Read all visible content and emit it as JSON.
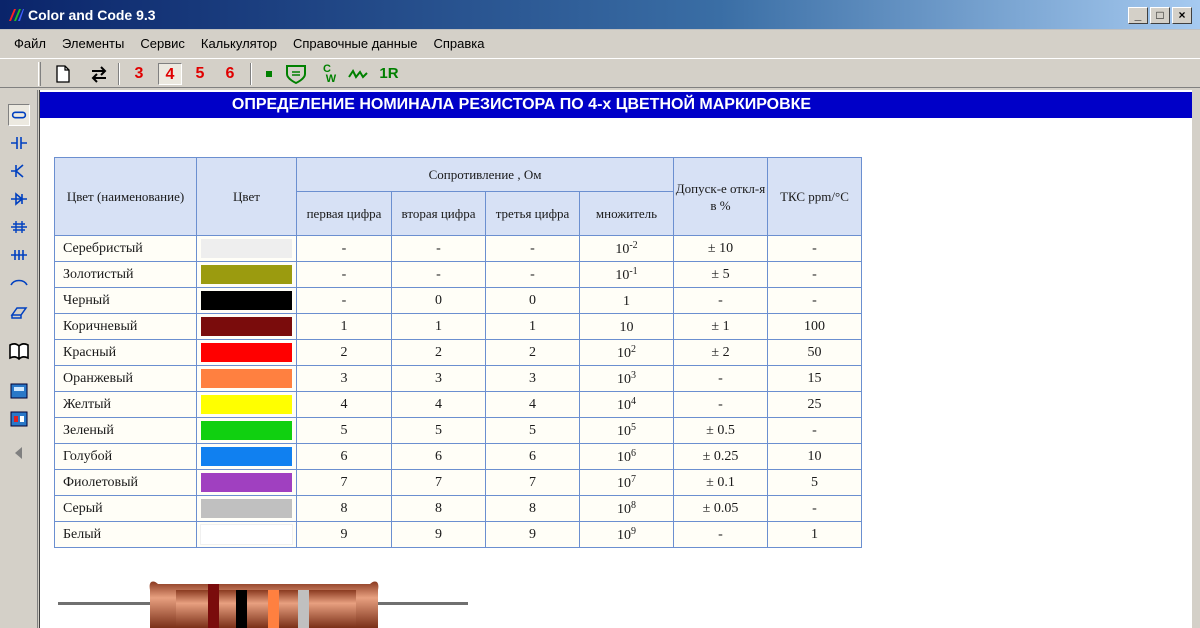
{
  "window": {
    "title": "Color and Code 9.3",
    "minimize": "_",
    "maximize": "□",
    "close": "×"
  },
  "menu": [
    "Файл",
    "Элементы",
    "Сервис",
    "Калькулятор",
    "Справочные данные",
    "Справка"
  ],
  "toolbar": {
    "band3": "3",
    "band4": "4",
    "band5": "5",
    "band6": "6",
    "one_r": "1R",
    "cc_top": "C",
    "cc_bottom": "W"
  },
  "banner": "ОПРЕДЕЛЕНИЕ НОМИНАЛА РЕЗИСТОРА ПО 4-х ЦВЕТНОЙ МАРКИРОВКЕ",
  "table": {
    "headers": {
      "color_name": "Цвет (наименование)",
      "color": "Цвет",
      "resistance": "Сопротивление , Ом",
      "first_digit": "первая цифра",
      "second_digit": "вторая цифра",
      "third_digit": "третья цифра",
      "multiplier": "множитель",
      "tolerance": "Допуск-е откл-я в %",
      "tcr": "ТКС ppm/°C"
    },
    "rows": [
      {
        "name": "Серебристый",
        "color": "#eeeeee",
        "d1": "-",
        "d2": "-",
        "d3": "-",
        "mult_base": "10",
        "mult_exp": "-2",
        "tol": "± 10",
        "tcr": "-"
      },
      {
        "name": "Золотистый",
        "color": "#9b9b0f",
        "d1": "-",
        "d2": "-",
        "d3": "-",
        "mult_base": "10",
        "mult_exp": "-1",
        "tol": "± 5",
        "tcr": "-"
      },
      {
        "name": "Черный",
        "color": "#000000",
        "d1": "-",
        "d2": "0",
        "d3": "0",
        "mult_base": "1",
        "mult_exp": "",
        "tol": "-",
        "tcr": "-"
      },
      {
        "name": "Коричневый",
        "color": "#7a0c0c",
        "d1": "1",
        "d2": "1",
        "d3": "1",
        "mult_base": "10",
        "mult_exp": "",
        "tol": "± 1",
        "tcr": "100"
      },
      {
        "name": "Красный",
        "color": "#ff0000",
        "d1": "2",
        "d2": "2",
        "d3": "2",
        "mult_base": "10",
        "mult_exp": "2",
        "tol": "± 2",
        "tcr": "50"
      },
      {
        "name": "Оранжевый",
        "color": "#ff8040",
        "d1": "3",
        "d2": "3",
        "d3": "3",
        "mult_base": "10",
        "mult_exp": "3",
        "tol": "-",
        "tcr": "15"
      },
      {
        "name": "Желтый",
        "color": "#ffff00",
        "d1": "4",
        "d2": "4",
        "d3": "4",
        "mult_base": "10",
        "mult_exp": "4",
        "tol": "-",
        "tcr": "25"
      },
      {
        "name": "Зеленый",
        "color": "#10d010",
        "d1": "5",
        "d2": "5",
        "d3": "5",
        "mult_base": "10",
        "mult_exp": "5",
        "tol": "± 0.5",
        "tcr": "-"
      },
      {
        "name": "Голубой",
        "color": "#1080f0",
        "d1": "6",
        "d2": "6",
        "d3": "6",
        "mult_base": "10",
        "mult_exp": "6",
        "tol": "± 0.25",
        "tcr": "10"
      },
      {
        "name": "Фиолетовый",
        "color": "#a040c0",
        "d1": "7",
        "d2": "7",
        "d3": "7",
        "mult_base": "10",
        "mult_exp": "7",
        "tol": "± 0.1",
        "tcr": "5"
      },
      {
        "name": "Серый",
        "color": "#c0c0c0",
        "d1": "8",
        "d2": "8",
        "d3": "8",
        "mult_base": "10",
        "mult_exp": "8",
        "tol": "± 0.05",
        "tcr": "-"
      },
      {
        "name": "Белый",
        "color": "#ffffff",
        "d1": "9",
        "d2": "9",
        "d3": "9",
        "mult_base": "10",
        "mult_exp": "9",
        "tol": "-",
        "tcr": "1"
      }
    ]
  },
  "resistor": {
    "band_colors": [
      "#7a0c0c",
      "#000000",
      "#ff8040",
      "#c0c0c0"
    ],
    "body_color": "#c8704a"
  },
  "colors": {
    "banner": "#0000c8",
    "header_bg": "#d7e1f5",
    "table_border": "#6b8fd0",
    "toolbar_red": "#e00000",
    "toolbar_green": "#008000"
  }
}
